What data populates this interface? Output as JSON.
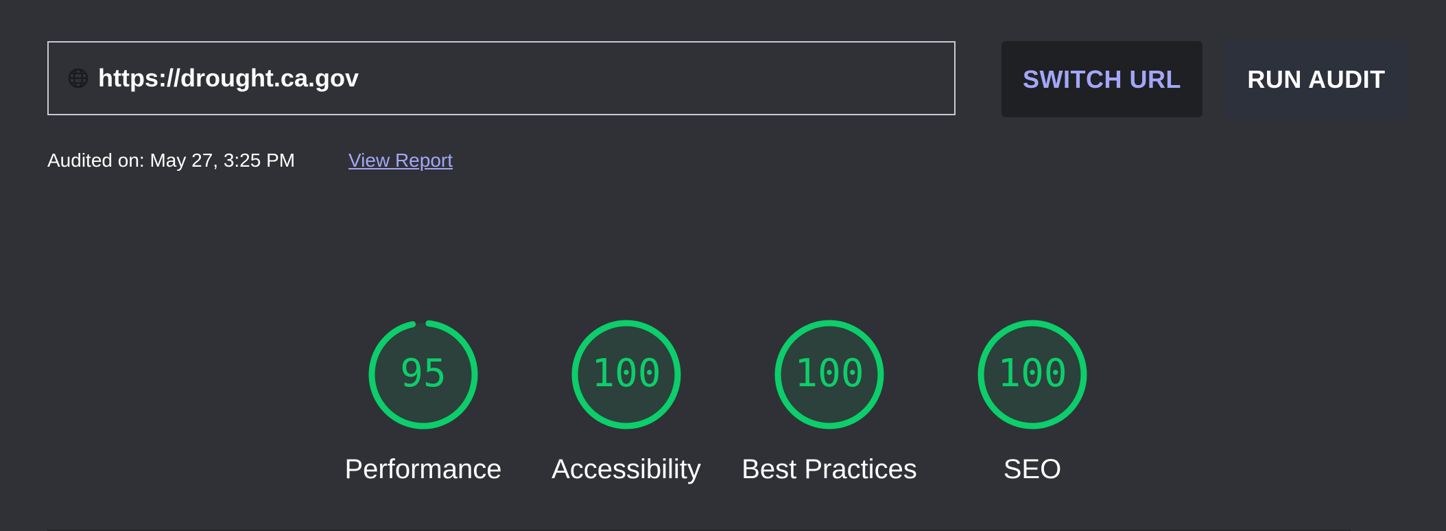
{
  "url_bar": {
    "value": "https://drought.ca.gov",
    "icon": "globe-icon"
  },
  "buttons": {
    "switch_url": "SWITCH URL",
    "run_audit": "RUN AUDIT"
  },
  "audit_info": {
    "audited_on": "Audited on: May 27, 3:25 PM",
    "view_report": "View Report"
  },
  "scores": [
    {
      "label": "Performance",
      "score": "95",
      "value": 95
    },
    {
      "label": "Accessibility",
      "score": "100",
      "value": 100
    },
    {
      "label": "Best Practices",
      "score": "100",
      "value": 100
    },
    {
      "label": "SEO",
      "score": "100",
      "value": 100
    }
  ],
  "colors": {
    "background": "#303136",
    "pass": "#0cce6b",
    "accent_link": "#a4a7f7"
  }
}
